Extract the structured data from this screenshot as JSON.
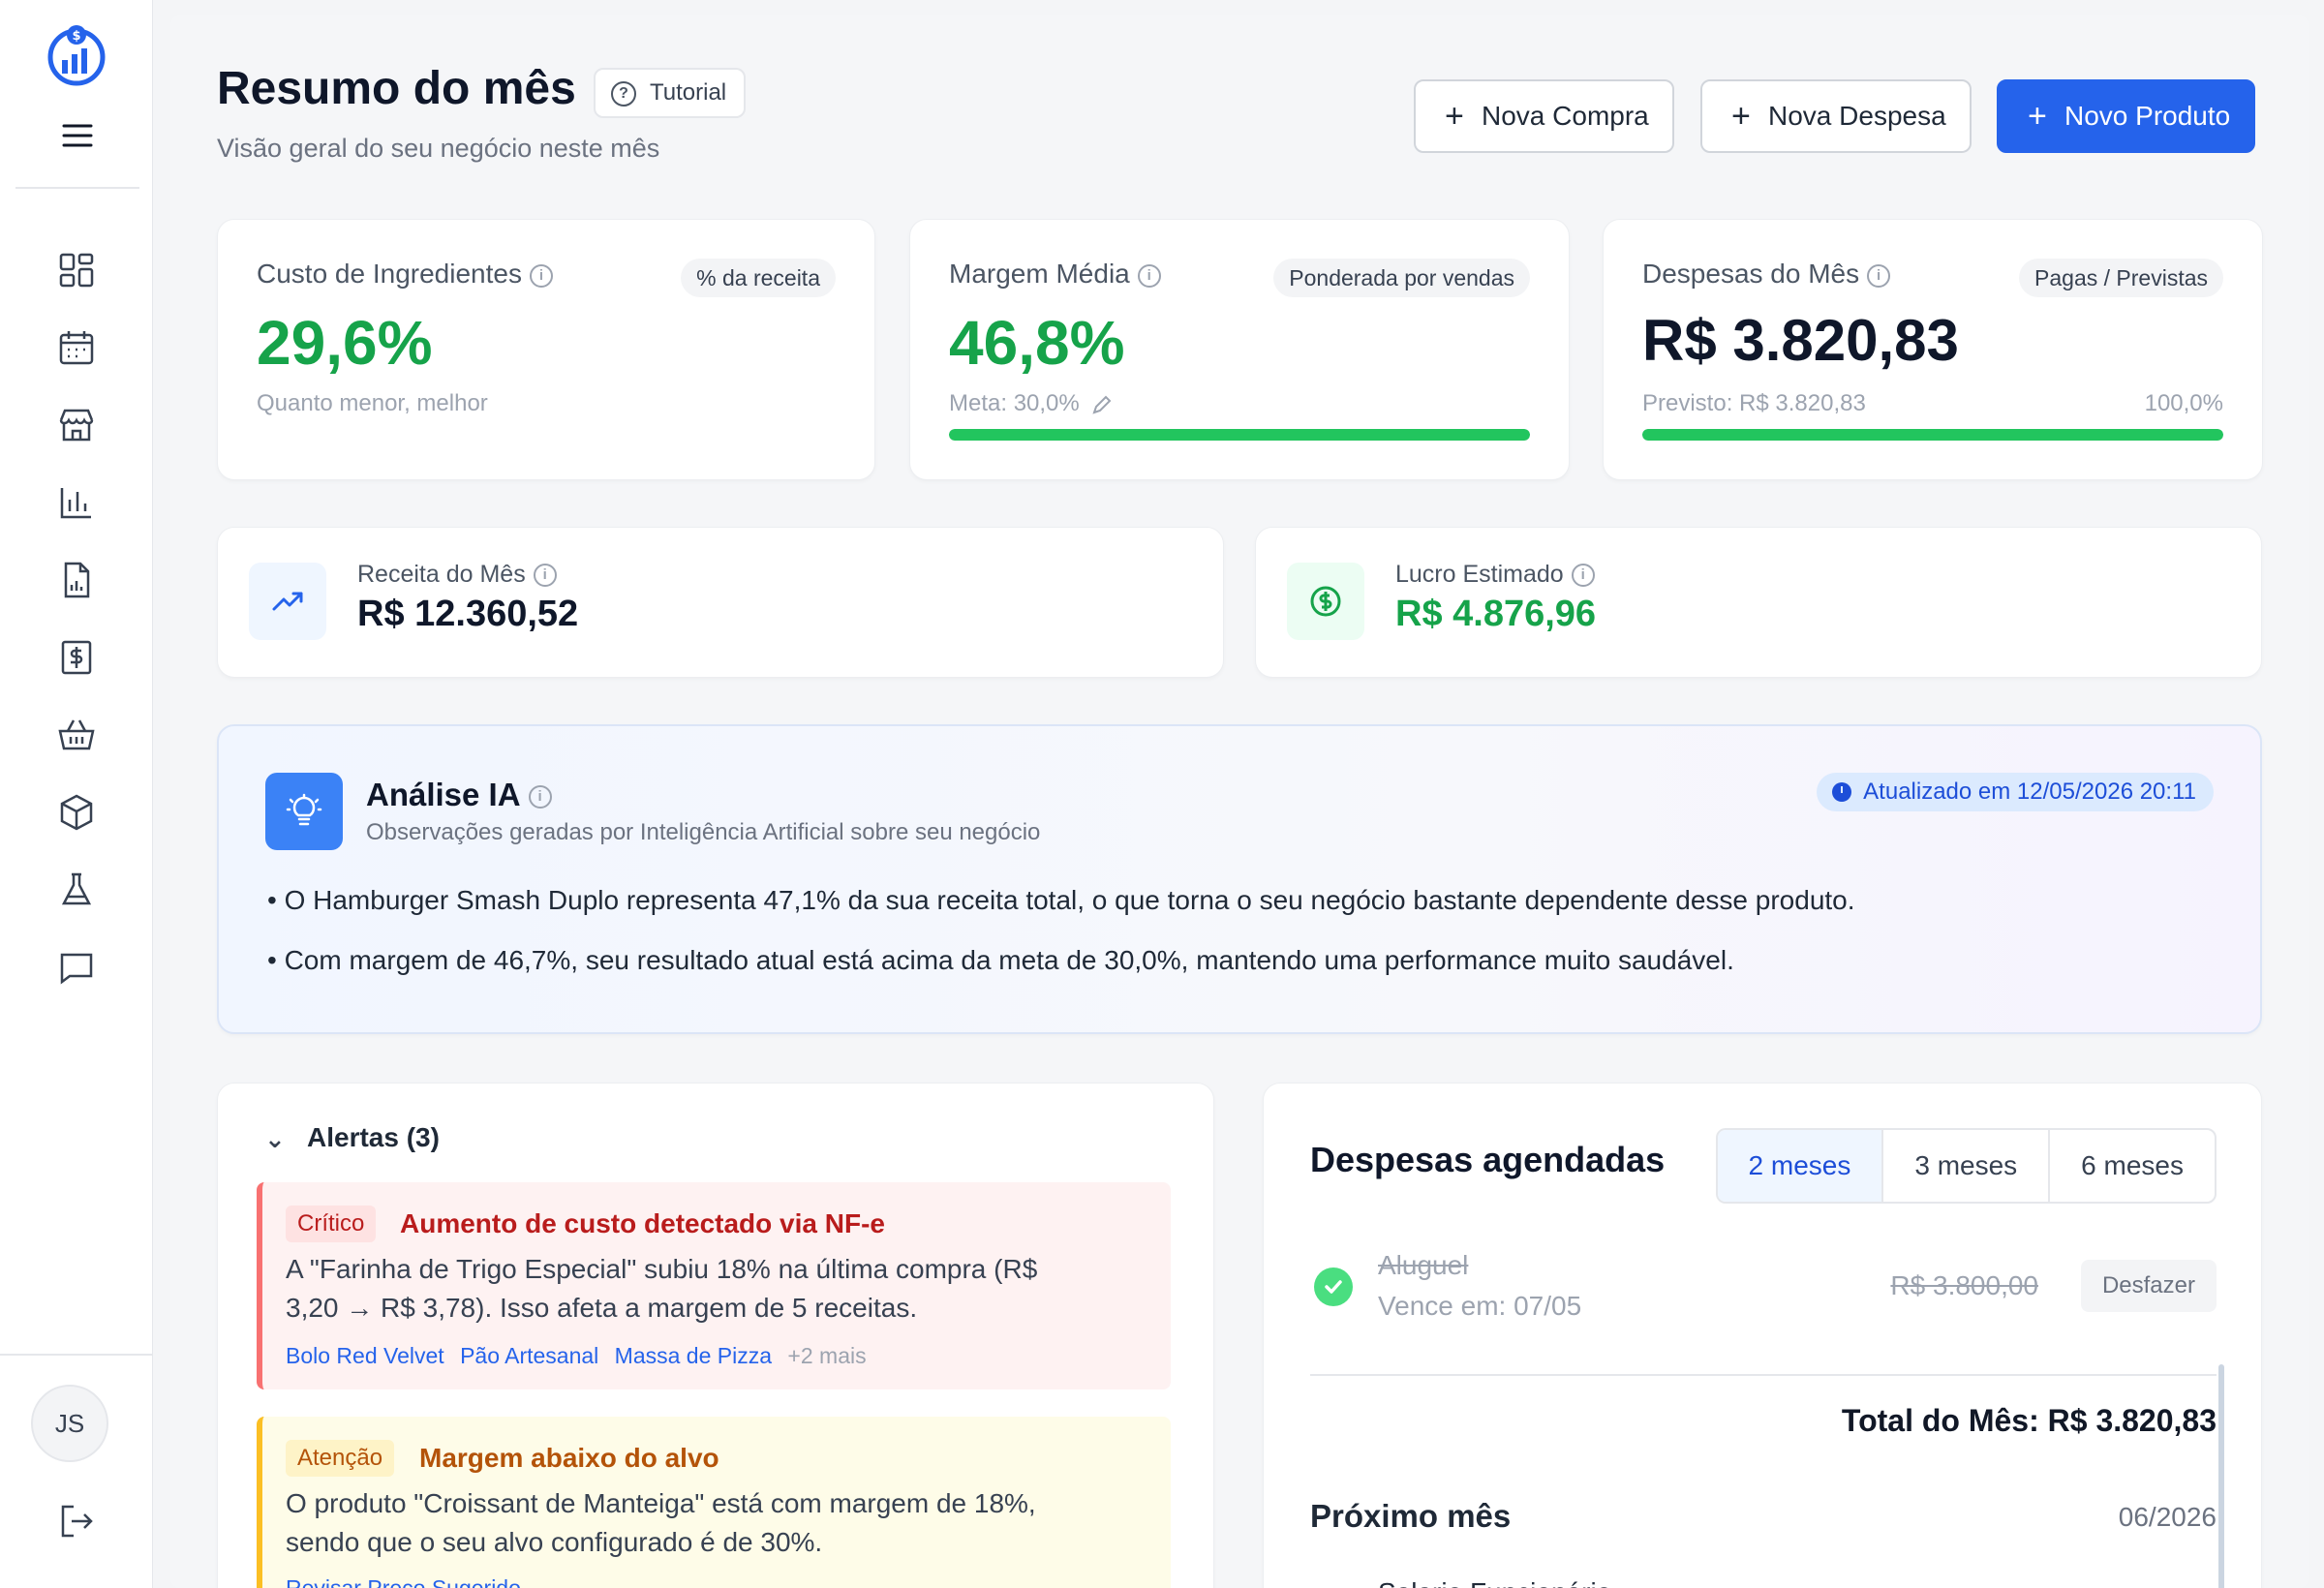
{
  "user": {
    "initials": "JS"
  },
  "header": {
    "title": "Resumo do mês",
    "tutorial_label": "Tutorial",
    "subtitle": "Visão geral do seu negócio neste mês",
    "buttons": {
      "nova_compra": "Nova Compra",
      "nova_despesa": "Nova Despesa",
      "novo_produto": "Novo Produto"
    }
  },
  "kpis": {
    "ingredientes": {
      "label": "Custo de Ingredientes",
      "chip": "% da receita",
      "value": "29,6%",
      "foot": "Quanto menor, melhor"
    },
    "margem": {
      "label": "Margem Média",
      "chip": "Ponderada por vendas",
      "value": "46,8%",
      "goal": "Meta: 30,0%",
      "progress": 1.0
    },
    "despesas": {
      "label": "Despesas do Mês",
      "chip": "Pagas / Previstas",
      "value": "R$ 3.820,83",
      "forecast": "Previsto: R$ 3.820,83",
      "percent": "100,0%",
      "progress": 1.0
    }
  },
  "mini": {
    "receita": {
      "label": "Receita do Mês",
      "value": "R$ 12.360,52"
    },
    "lucro": {
      "label": "Lucro Estimado",
      "value": "R$ 4.876,96"
    }
  },
  "ai": {
    "title": "Análise IA",
    "subtitle": "Observações geradas por Inteligência Artificial sobre seu negócio",
    "updated": "Atualizado em 12/05/2026 20:11",
    "bullets": [
      "• O Hamburger Smash Duplo representa 47,1% da sua receita total, o que torna o seu negócio bastante dependente desse produto.",
      "• Com margem de 46,7%, seu resultado atual está acima da meta de 30,0%, mantendo uma performance muito saudável."
    ]
  },
  "alerts": {
    "title": "Alertas (3)",
    "items": [
      {
        "tag": "Crítico",
        "title": "Aumento de custo detectado via NF-e",
        "text1": "A \"Farinha de Trigo Especial\" subiu 18% na última compra (R$",
        "text2": "3,20 → R$ 3,78). Isso afeta a margem de 5 receitas.",
        "links": [
          "Bolo Red Velvet",
          "Pão Artesanal",
          "Massa de Pizza"
        ],
        "more": "+2 mais"
      },
      {
        "tag": "Atenção",
        "title": "Margem abaixo do alvo",
        "text1": "O produto \"Croissant de Manteiga\" está com margem de 18%,",
        "text2": "sendo que o seu alvo configurado é de 30%.",
        "link": "Revisar Preço Sugerido"
      }
    ]
  },
  "scheduled": {
    "title": "Despesas agendadas",
    "tabs": [
      "2 meses",
      "3 meses",
      "6 meses"
    ],
    "expense": {
      "name": "Aluguel",
      "due": "Vence em: 07/05",
      "amount": "R$ 3.800,00",
      "undo": "Desfazer"
    },
    "total": "Total do Mês: R$ 3.820,83",
    "next_label": "Próximo mês",
    "next_date": "06/2026",
    "next_item": "Salario Funcionário"
  },
  "colors": {
    "primary": "#2563eb",
    "success": "#16a34a",
    "danger": "#b91c1c",
    "warning": "#b45309"
  }
}
